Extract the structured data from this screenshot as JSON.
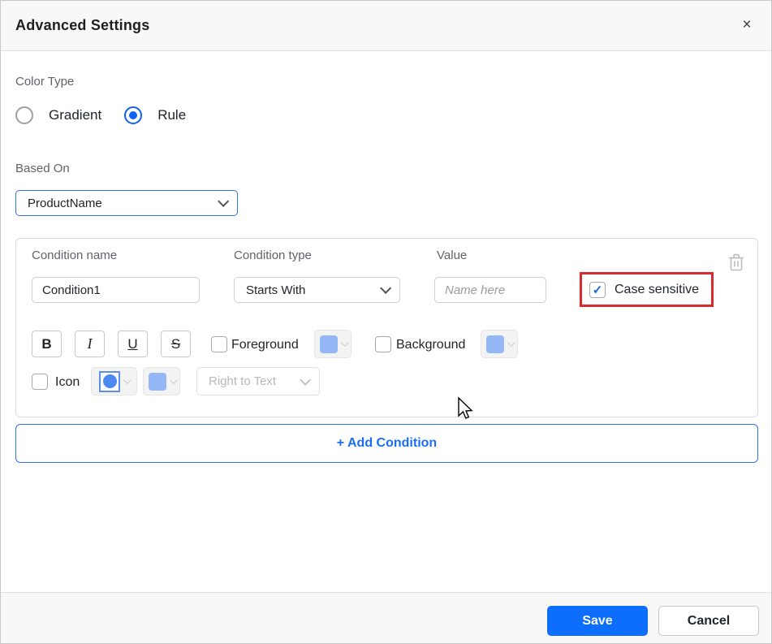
{
  "header": {
    "title": "Advanced Settings",
    "close_glyph": "×"
  },
  "color_type": {
    "label": "Color Type",
    "options": [
      {
        "label": "Gradient",
        "selected": false
      },
      {
        "label": "Rule",
        "selected": true
      }
    ]
  },
  "based_on": {
    "label": "Based On",
    "value": "ProductName"
  },
  "condition": {
    "name_label": "Condition name",
    "name_value": "Condition1",
    "type_label": "Condition type",
    "type_value": "Starts With",
    "value_label": "Value",
    "value_placeholder": "Name here",
    "case_sensitive": {
      "label": "Case sensitive",
      "checked": true,
      "check_glyph": "✓"
    },
    "format": {
      "bold": "B",
      "italic": "I",
      "underline": "U",
      "strikethrough": "S"
    },
    "foreground_label": "Foreground",
    "background_label": "Background",
    "icon_label": "Icon",
    "icon_position": "Right to Text"
  },
  "add_condition_label": "+ Add Condition",
  "footer": {
    "save": "Save",
    "cancel": "Cancel"
  },
  "colors": {
    "accent_blue": "#0d6efd",
    "swatch_blue": "#94b7f7",
    "highlight_red": "#d92b2b"
  }
}
